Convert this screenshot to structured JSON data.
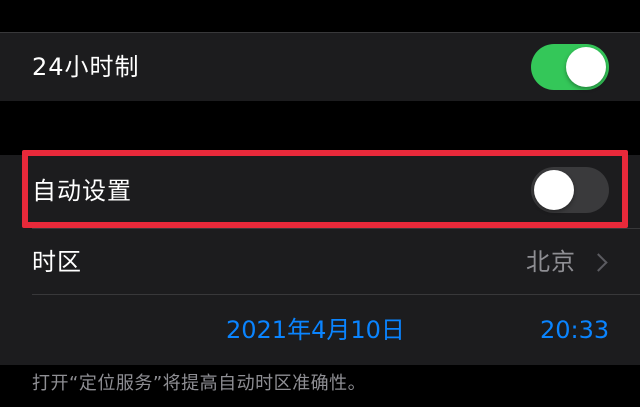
{
  "time_format": {
    "label": "24小时制",
    "enabled": true
  },
  "auto_set": {
    "label": "自动设置",
    "enabled": false,
    "highlight_color": "#e8293a"
  },
  "time_zone": {
    "label": "时区",
    "value": "北京",
    "icon": "chevron-right-icon"
  },
  "date_time": {
    "date": "2021年4月10日",
    "time": "20:33"
  },
  "footer_note": "打开“定位服务”将提高自动时区准确性。",
  "colors": {
    "accent": "#0a84ff",
    "toggle_on": "#34c759",
    "background": "#000000",
    "cell": "#1c1c1e"
  }
}
